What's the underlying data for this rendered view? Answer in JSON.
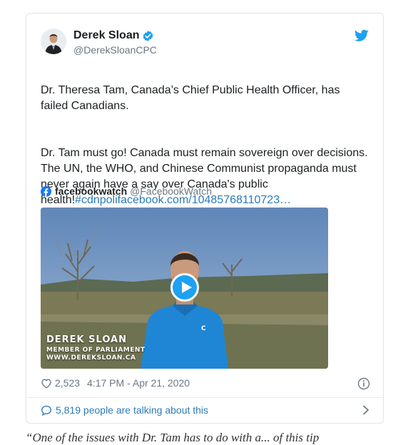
{
  "author": {
    "display_name": "Derek Sloan",
    "handle": "@DerekSloanCPC"
  },
  "tweet": {
    "paragraph1": "Dr. Theresa Tam, Canada’s Chief Public Health Officer, has failed Canadians.",
    "paragraph2_text": "Dr. Tam must go! Canada must remain sovereign over decisions. The UN, the WHO, and Chinese Communist propaganda must never again have a say over Canada's public health!",
    "hashtag": "#cdnpoli",
    "link": "facebook.com/10485768110723…"
  },
  "quote": {
    "name": "facebookwatch",
    "handle": "@FacebookWatch"
  },
  "video": {
    "caption_name": "DEREK SLOAN",
    "caption_title": "MEMBER OF PARLIAMENT",
    "caption_url": "WWW.DEREKSLOAN.CA",
    "jacket_text": "C"
  },
  "meta": {
    "likes": "2,523",
    "timestamp": "4:17 PM - Apr 21, 2020"
  },
  "talking": {
    "text": "5,819 people are talking about this"
  },
  "page_below": {
    "text": "“One of the issues with Dr. Tam has to do with a... of this tip"
  },
  "colors": {
    "twitter_blue": "#1da1f2",
    "link_blue": "#2b7bb9",
    "muted_gray": "#697882",
    "facebook_blue": "#1877f2"
  }
}
